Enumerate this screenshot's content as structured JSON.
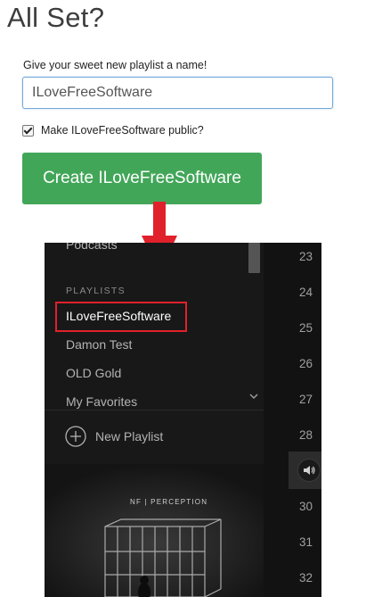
{
  "header": {
    "title": "All Set?"
  },
  "form": {
    "prompt": "Give your sweet new playlist a name!",
    "name_value": "ILoveFreeSoftware",
    "public_label": "Make ILoveFreeSoftware public?",
    "public_checked": true,
    "create_label": "Create ILoveFreeSoftware"
  },
  "sidebar": {
    "top_item": "Podcasts",
    "section_label": "PLAYLISTS",
    "playlists": [
      "ILoveFreeSoftware",
      "Damon Test",
      "OLD Gold",
      "My Favorites"
    ],
    "new_playlist_label": "New Playlist",
    "album_cover_text": "NF | PERCEPTION"
  },
  "tracklist": {
    "numbers": [
      "23",
      "24",
      "25",
      "26",
      "27",
      "28",
      "30",
      "31",
      "32"
    ]
  },
  "colors": {
    "create_button": "#42a659",
    "highlight_border": "#e0212b",
    "arrow": "#e0212b",
    "player_bg": "#121212"
  }
}
